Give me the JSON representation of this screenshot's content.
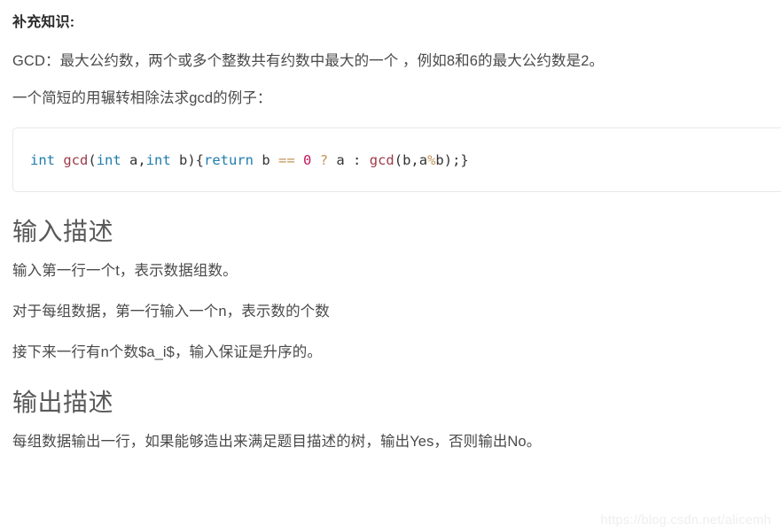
{
  "document": {
    "lead_heading": "补充知识:",
    "paragraphs": [
      "GCD：最大公约数，两个或多个整数共有约数中最大的一个 ，例如8和6的最大公约数是2。",
      "一个简短的用辗转相除法求gcd的例子："
    ],
    "code_block": {
      "language": "c",
      "tokens": [
        {
          "text": "int",
          "type": "keyword"
        },
        {
          "text": " ",
          "type": "plain"
        },
        {
          "text": "gcd",
          "type": "function"
        },
        {
          "text": "(",
          "type": "punct"
        },
        {
          "text": "int",
          "type": "keyword"
        },
        {
          "text": " a,",
          "type": "plain"
        },
        {
          "text": "int",
          "type": "keyword"
        },
        {
          "text": " b){",
          "type": "plain"
        },
        {
          "text": "return",
          "type": "keyword"
        },
        {
          "text": " b ",
          "type": "plain"
        },
        {
          "text": "==",
          "type": "operator"
        },
        {
          "text": " ",
          "type": "plain"
        },
        {
          "text": "0",
          "type": "number"
        },
        {
          "text": " ",
          "type": "plain"
        },
        {
          "text": "?",
          "type": "operator"
        },
        {
          "text": " a : ",
          "type": "plain"
        },
        {
          "text": "gcd",
          "type": "function"
        },
        {
          "text": "(b,a",
          "type": "plain"
        },
        {
          "text": "%",
          "type": "operator"
        },
        {
          "text": "b);}",
          "type": "plain"
        }
      ],
      "plain_text": "int gcd(int a,int b){return b == 0 ? a : gcd(b,a%b);}"
    },
    "sections": [
      {
        "heading": "输入描述",
        "paragraphs": [
          "输入第一行一个t，表示数据组数。",
          "对于每组数据，第一行输入一个n，表示数的个数",
          "接下来一行有n个数$a_i$，输入保证是升序的。"
        ]
      },
      {
        "heading": "输出描述",
        "paragraphs": [
          "每组数据输出一行，如果能够造出来满足题目描述的树，输出Yes，否则输出No。"
        ]
      }
    ],
    "watermark": "https://blog.csdn.net/alicemh"
  },
  "colors": {
    "page_background": "#ffffff",
    "body_text": "#4a4a4a",
    "heading_text": "#595959",
    "lead_heading_text": "#2b2b2b",
    "code_border": "#e8e8e8",
    "code_keyword": "#1f7cad",
    "code_function": "#9b3b4a",
    "code_operator": "#c2955a",
    "code_number": "#c2185b",
    "code_plain": "#333333",
    "watermark_text": "#eeeeee"
  }
}
